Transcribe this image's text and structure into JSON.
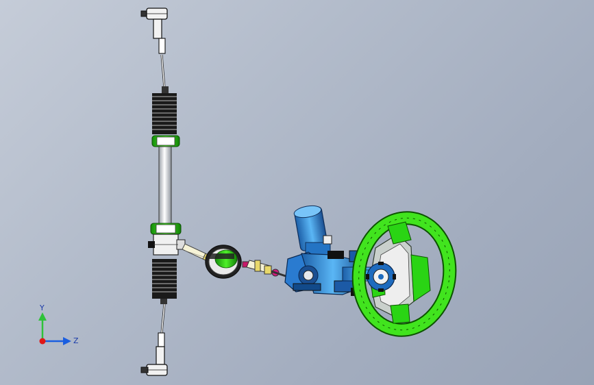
{
  "viewport": {
    "background_top": "#c5ccd8",
    "background_bottom": "#98a3b6"
  },
  "model": {
    "assembly": "steering-system",
    "components": [
      "tie-rod-end-top",
      "tie-rod-top",
      "rack-boot-top",
      "rack-clamp-top",
      "rack-housing",
      "rack-clamp-bottom",
      "pinion-housing",
      "rack-boot-bottom",
      "tie-rod-bottom",
      "tie-rod-end-bottom",
      "intermediate-shaft",
      "steering-dust-boot",
      "universal-joint",
      "eps-motor",
      "column-housing",
      "steering-column",
      "steering-wheel"
    ],
    "colors": {
      "green": "#33d617",
      "blue": "#3a9ee8",
      "dark_blue": "#1d5aa8",
      "silver": "#e6e8ec",
      "yellow": "#e8d86a",
      "magenta": "#d21a7c"
    }
  },
  "triad": {
    "y_label": "Y",
    "z_label": "Z",
    "colors": {
      "x": "#e01818",
      "y": "#2fc23a",
      "z": "#1a5ee0"
    }
  }
}
